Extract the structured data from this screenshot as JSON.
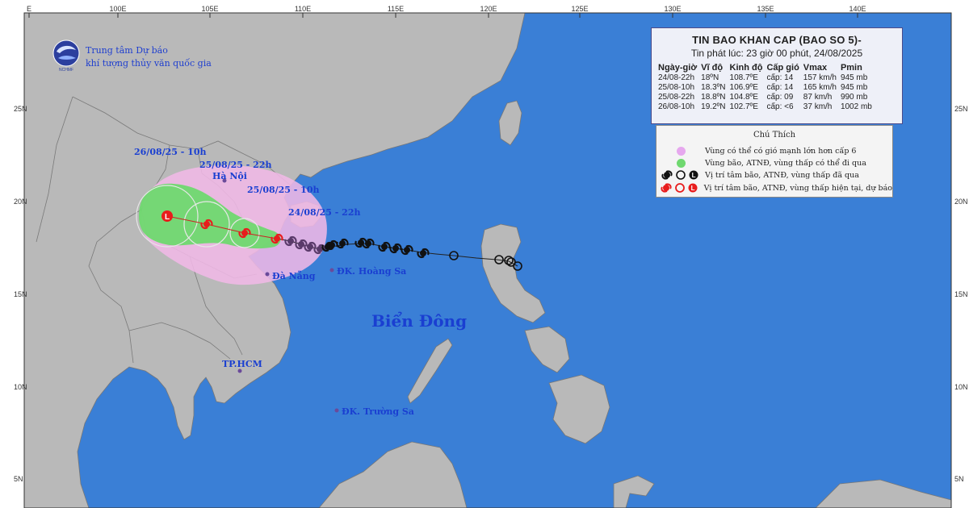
{
  "map": {
    "lon_ticks": [
      "E",
      "100E",
      "105E",
      "110E",
      "115E",
      "120E",
      "125E",
      "130E",
      "135E",
      "140E"
    ],
    "lat_ticks": [
      "25N",
      "20N",
      "15N",
      "10N",
      "5N"
    ],
    "colors": {
      "sea": "#3a7fd6",
      "land": "#b9b9b9",
      "border": "#7a7a7a",
      "strong_wind": "#f0b8e6",
      "danger": "#6fd86f"
    },
    "places": {
      "ha_noi": "Hà Nội",
      "da_nang": "Đà Nẵng",
      "hoang_sa": "ĐK. Hoàng Sa",
      "bien_dong": "Biển Đông",
      "tp_hcm": "TP.HCM",
      "truong_sa": "ĐK. Trường Sa"
    },
    "date_labels": [
      "26/08/25 - 10h",
      "25/08/25 - 22h",
      "25/08/25 - 10h",
      "24/08/25 - 22h"
    ]
  },
  "logo": {
    "line1": "Trung tâm Dự báo",
    "line2": "khí tượng thủy văn quốc gia",
    "badge": "NCHMF"
  },
  "info": {
    "title": "TIN BAO KHAN CAP (BAO SO 5)-",
    "issued": "Tin phát lúc: 23 giờ 00 phút, 24/08/2025",
    "headers": [
      "Ngày-giờ",
      "Vĩ độ",
      "Kinh độ",
      "Cấp gió",
      "Vmax",
      "Pmin"
    ],
    "rows": [
      [
        "24/08-22h",
        "18ºN",
        "108.7ºE",
        "cấp: 14",
        "157 km/h",
        "945 mb"
      ],
      [
        "25/08-10h",
        "18.3ºN",
        "106.9ºE",
        "cấp: 14",
        "165 km/h",
        "945 mb"
      ],
      [
        "25/08-22h",
        "18.8ºN",
        "104.8ºE",
        "cấp: 09",
        "87 km/h",
        "990 mb"
      ],
      [
        "26/08-10h",
        "19.2ºN",
        "102.7ºE",
        "cấp: <6",
        "37 km/h",
        "1002 mb"
      ]
    ]
  },
  "legend": {
    "title": "Chú Thích",
    "items": [
      "Vùng có thể có gió mạnh lớn hơn cấp 6",
      "Vùng bão, ATNĐ, vùng thấp có thể đi qua",
      "Vị trí tâm bão, ATNĐ, vùng thấp đã qua",
      "Vị trí tâm bão, ATNĐ, vùng thấp hiện tại, dự báo"
    ]
  }
}
